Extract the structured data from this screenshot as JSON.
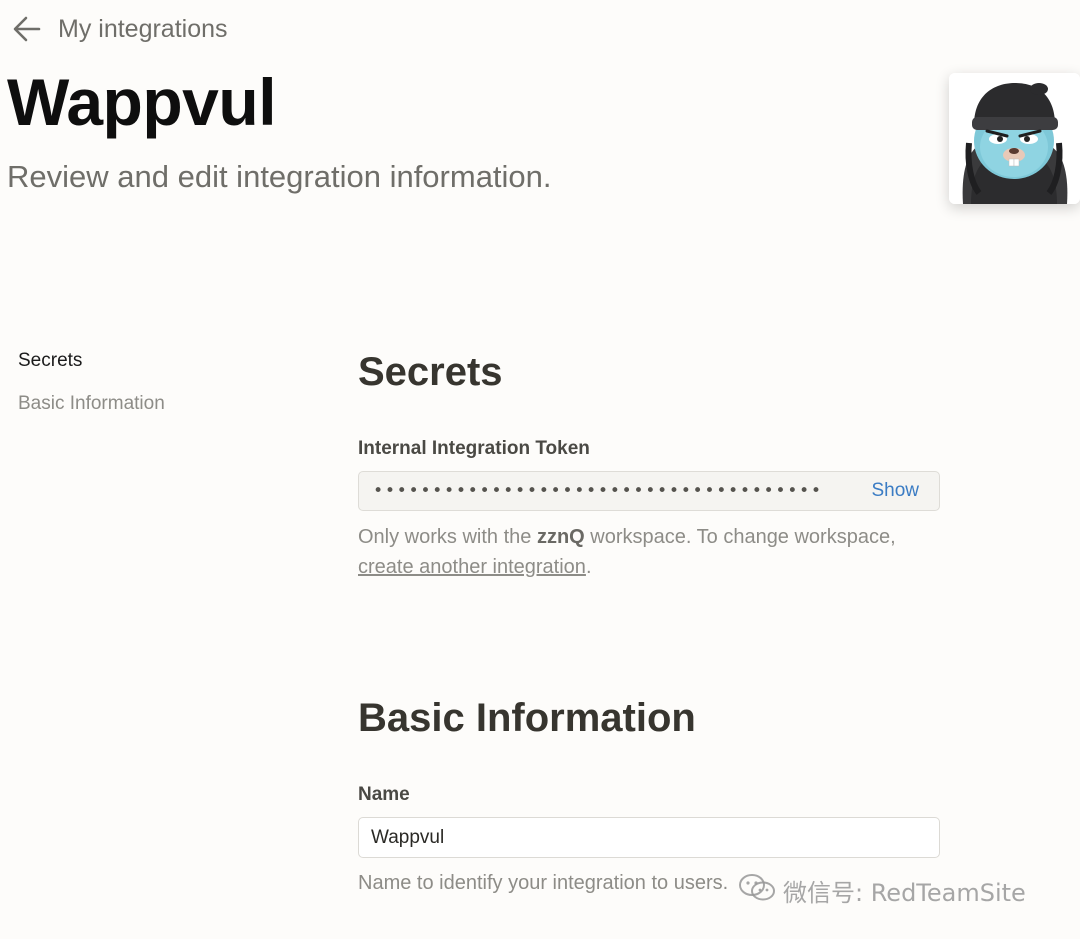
{
  "header": {
    "back_label": "My integrations",
    "title": "Wappvul",
    "subtitle": "Review and edit integration information."
  },
  "sidebar": {
    "items": [
      {
        "label": "Secrets",
        "active": true
      },
      {
        "label": "Basic Information",
        "active": false
      }
    ]
  },
  "secrets": {
    "heading": "Secrets",
    "token_label": "Internal Integration Token",
    "token_value": "••••••••••••••••••••••••••••••••••••••",
    "show_label": "Show",
    "help_prefix": "Only works with the ",
    "workspace_name": "zznQ",
    "help_middle": " workspace. To change workspace, ",
    "help_link": "create another integration",
    "help_suffix": "."
  },
  "basic_info": {
    "heading": "Basic Information",
    "name_label": "Name",
    "name_value": "Wappvul",
    "name_help": "Name to identify your integration to users."
  },
  "watermark": {
    "text": "微信号: RedTeamSite"
  },
  "colors": {
    "background": "#fdfcfa",
    "link_blue": "#3b7cc4",
    "muted_text": "#8d8c87",
    "heading_text": "#37352f"
  },
  "icons": {
    "back": "arrow-left-icon",
    "avatar": "gopher-avatar-icon",
    "watermark": "wechat-icon"
  }
}
